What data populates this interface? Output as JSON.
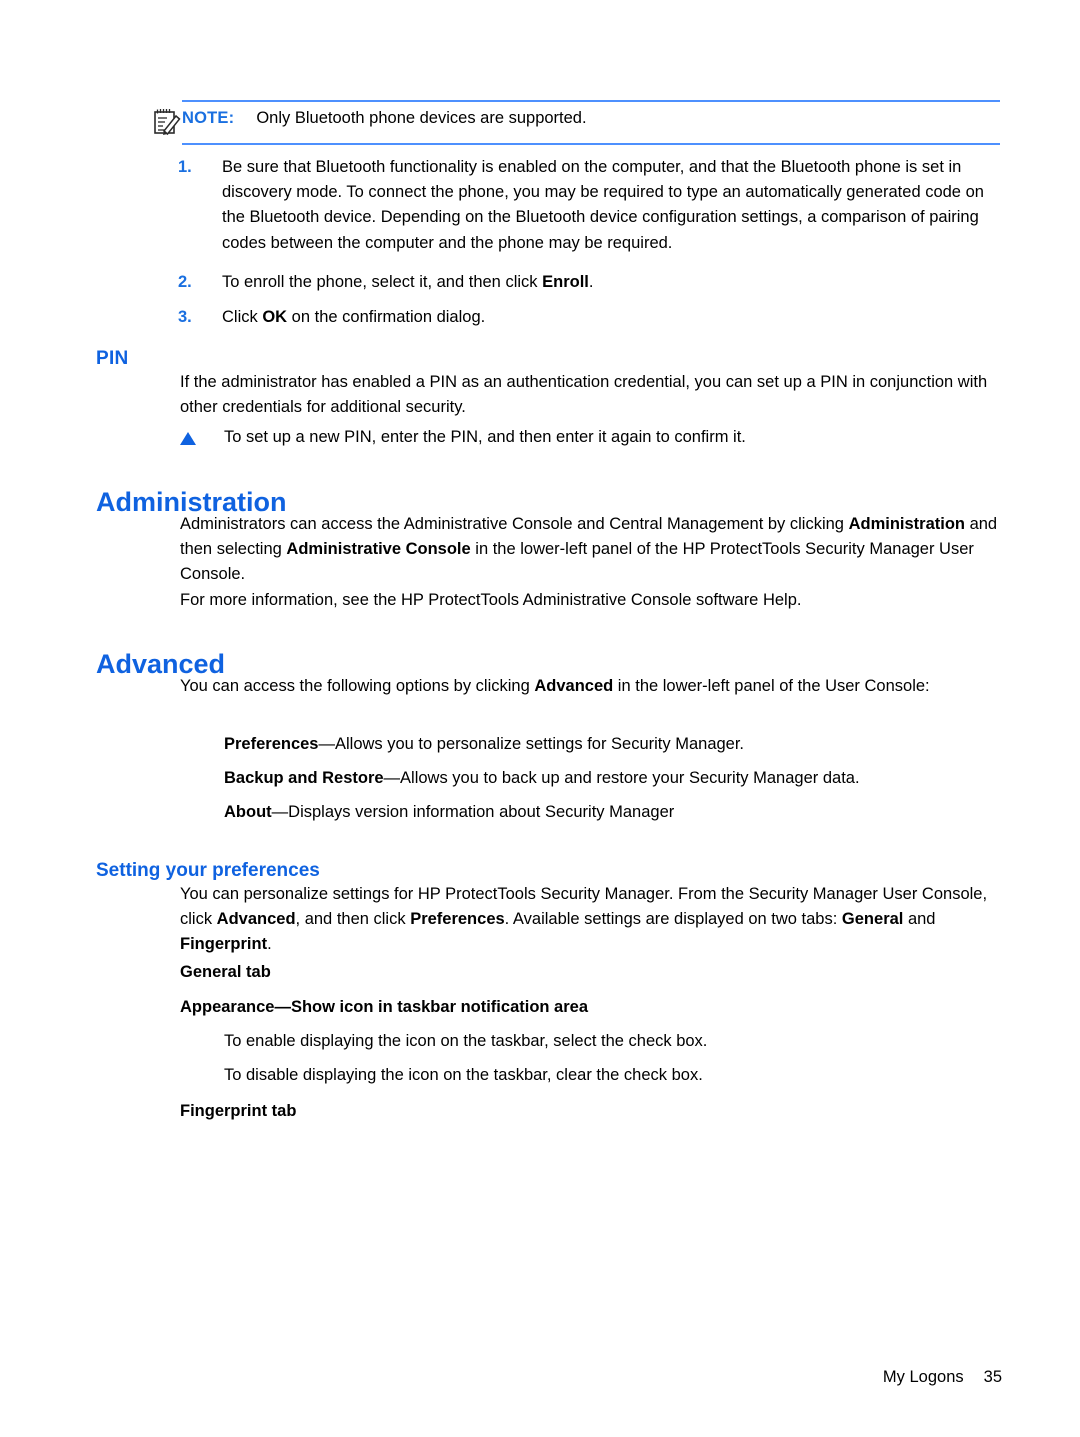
{
  "colors": {
    "heading_blue": "#0f62e0",
    "note_blue": "#1a6fe0",
    "rule_blue": "#4d90fe",
    "text_black": "#000000"
  },
  "note": {
    "icon": "note-pad-pencil-icon",
    "label": "NOTE:",
    "text": "Only Bluetooth phone devices are supported."
  },
  "procedure": {
    "items": [
      {
        "marker": "1.",
        "text": "Be sure that Bluetooth functionality is enabled on the computer, and that the Bluetooth phone is set in discovery mode. To connect the phone, you may be required to type an automatically generated code on the Bluetooth device. Depending on the Bluetooth device configuration settings, a comparison of pairing codes between the computer and the phone may be required."
      },
      {
        "marker": "2.",
        "text_before": "To enroll the phone, select it, and then click ",
        "text_bold": "Enroll",
        "text_after": "."
      },
      {
        "marker": "3.",
        "text_before": "Click ",
        "text_bold": "OK",
        "text_after": " on the confirmation dialog."
      }
    ]
  },
  "pin_section": {
    "heading": "PIN",
    "paragraph": "If the administrator has enabled a PIN as an authentication credential, you can set up a PIN in conjunction with other credentials for additional security.",
    "bullet": {
      "marker": "triangle-bullet-icon",
      "text": "To set up a new PIN, enter the PIN, and then enter it again to confirm it."
    }
  },
  "administration_section": {
    "heading": "Administration",
    "paragraph1": {
      "p1": "Administrators can access the Administrative Console and Central Management by clicking ",
      "b1": "Administration",
      "p2": " and then selecting ",
      "b2": "Administrative Console",
      "p3": " in the lower-left panel of the HP ProtectTools Security Manager User Console."
    },
    "paragraph2": "For more information, see the HP ProtectTools Administrative Console software Help."
  },
  "advanced_section": {
    "heading": "Advanced",
    "intro": {
      "p1": "You can access the following options by clicking ",
      "b1": "Advanced",
      "p2": " in the lower-left panel of the User Console:"
    },
    "options": [
      {
        "term": "Preferences",
        "dash": "—",
        "definition": "Allows you to personalize settings for Security Manager."
      },
      {
        "term": "Backup and Restore",
        "dash": "—",
        "definition": "Allows you to back up and restore your Security Manager data."
      },
      {
        "term": "About",
        "dash": "—",
        "definition": "Displays version information about Security Manager"
      }
    ]
  },
  "preferences_section": {
    "heading": "Setting your preferences",
    "paragraph": {
      "p1": "You can personalize settings for HP ProtectTools Security Manager. From the Security Manager User Console, click ",
      "b1": "Advanced",
      "p2": ", and then click ",
      "b2": "Preferences",
      "p3": ". Available settings are displayed on two tabs: ",
      "b3": "General",
      "p4": " and ",
      "b4": "Fingerprint",
      "p5": "."
    },
    "general_tab_label": "General tab",
    "appearance_label": "Appearance—Show icon in taskbar notification area",
    "enable_text": "To enable displaying the icon on the taskbar, select the check box.",
    "disable_text": "To disable displaying the icon on the taskbar, clear the check box.",
    "fingerprint_tab_label": "Fingerprint tab"
  },
  "footer": {
    "chapter": "My Logons",
    "page_number": "35"
  }
}
